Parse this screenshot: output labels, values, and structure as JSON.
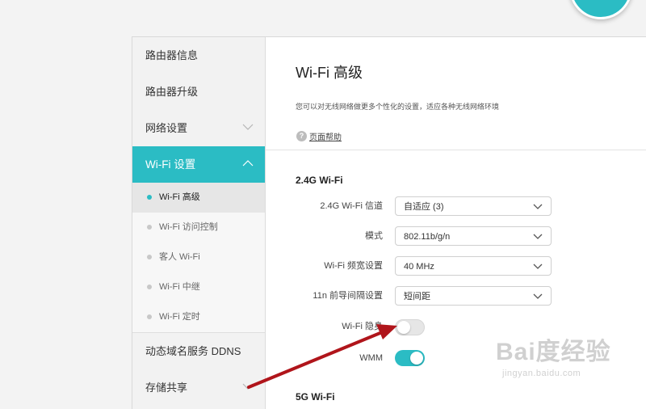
{
  "sidebar": {
    "items": [
      {
        "label": "路由器信息"
      },
      {
        "label": "路由器升级"
      },
      {
        "label": "网络设置"
      },
      {
        "label": "Wi-Fi 设置"
      },
      {
        "label": "动态域名服务 DDNS"
      },
      {
        "label": "存储共享"
      }
    ],
    "wifi_sub": [
      {
        "label": "Wi-Fi 高级"
      },
      {
        "label": "Wi-Fi 访问控制"
      },
      {
        "label": "客人 Wi-Fi"
      },
      {
        "label": "Wi-Fi 中继"
      },
      {
        "label": "Wi-Fi 定时"
      }
    ]
  },
  "main": {
    "title": "Wi-Fi 高级",
    "description": "您可以对无线网络做更多个性化的设置，适应各种无线网络环境",
    "help_label": "页面帮助",
    "help_icon_glyph": "?",
    "section_24": "2.4G Wi-Fi",
    "section_5": "5G Wi-Fi",
    "fields": {
      "channel": {
        "label": "2.4G Wi-Fi 信道",
        "value": "自适应 (3)"
      },
      "mode": {
        "label": "模式",
        "value": "802.11b/g/n"
      },
      "bandwidth": {
        "label": "Wi-Fi 频宽设置",
        "value": "40 MHz"
      },
      "guard": {
        "label": "11n 前导间隔设置",
        "value": "短间距"
      },
      "hidden": {
        "label": "Wi-Fi 隐身",
        "on": false
      },
      "wmm": {
        "label": "WMM",
        "on": true
      }
    }
  },
  "watermark": {
    "logo": "Bai度经验",
    "url": "jingyan.baidu.com"
  },
  "colors": {
    "accent": "#2bbcc4",
    "annotation_arrow": "#b0151b"
  }
}
